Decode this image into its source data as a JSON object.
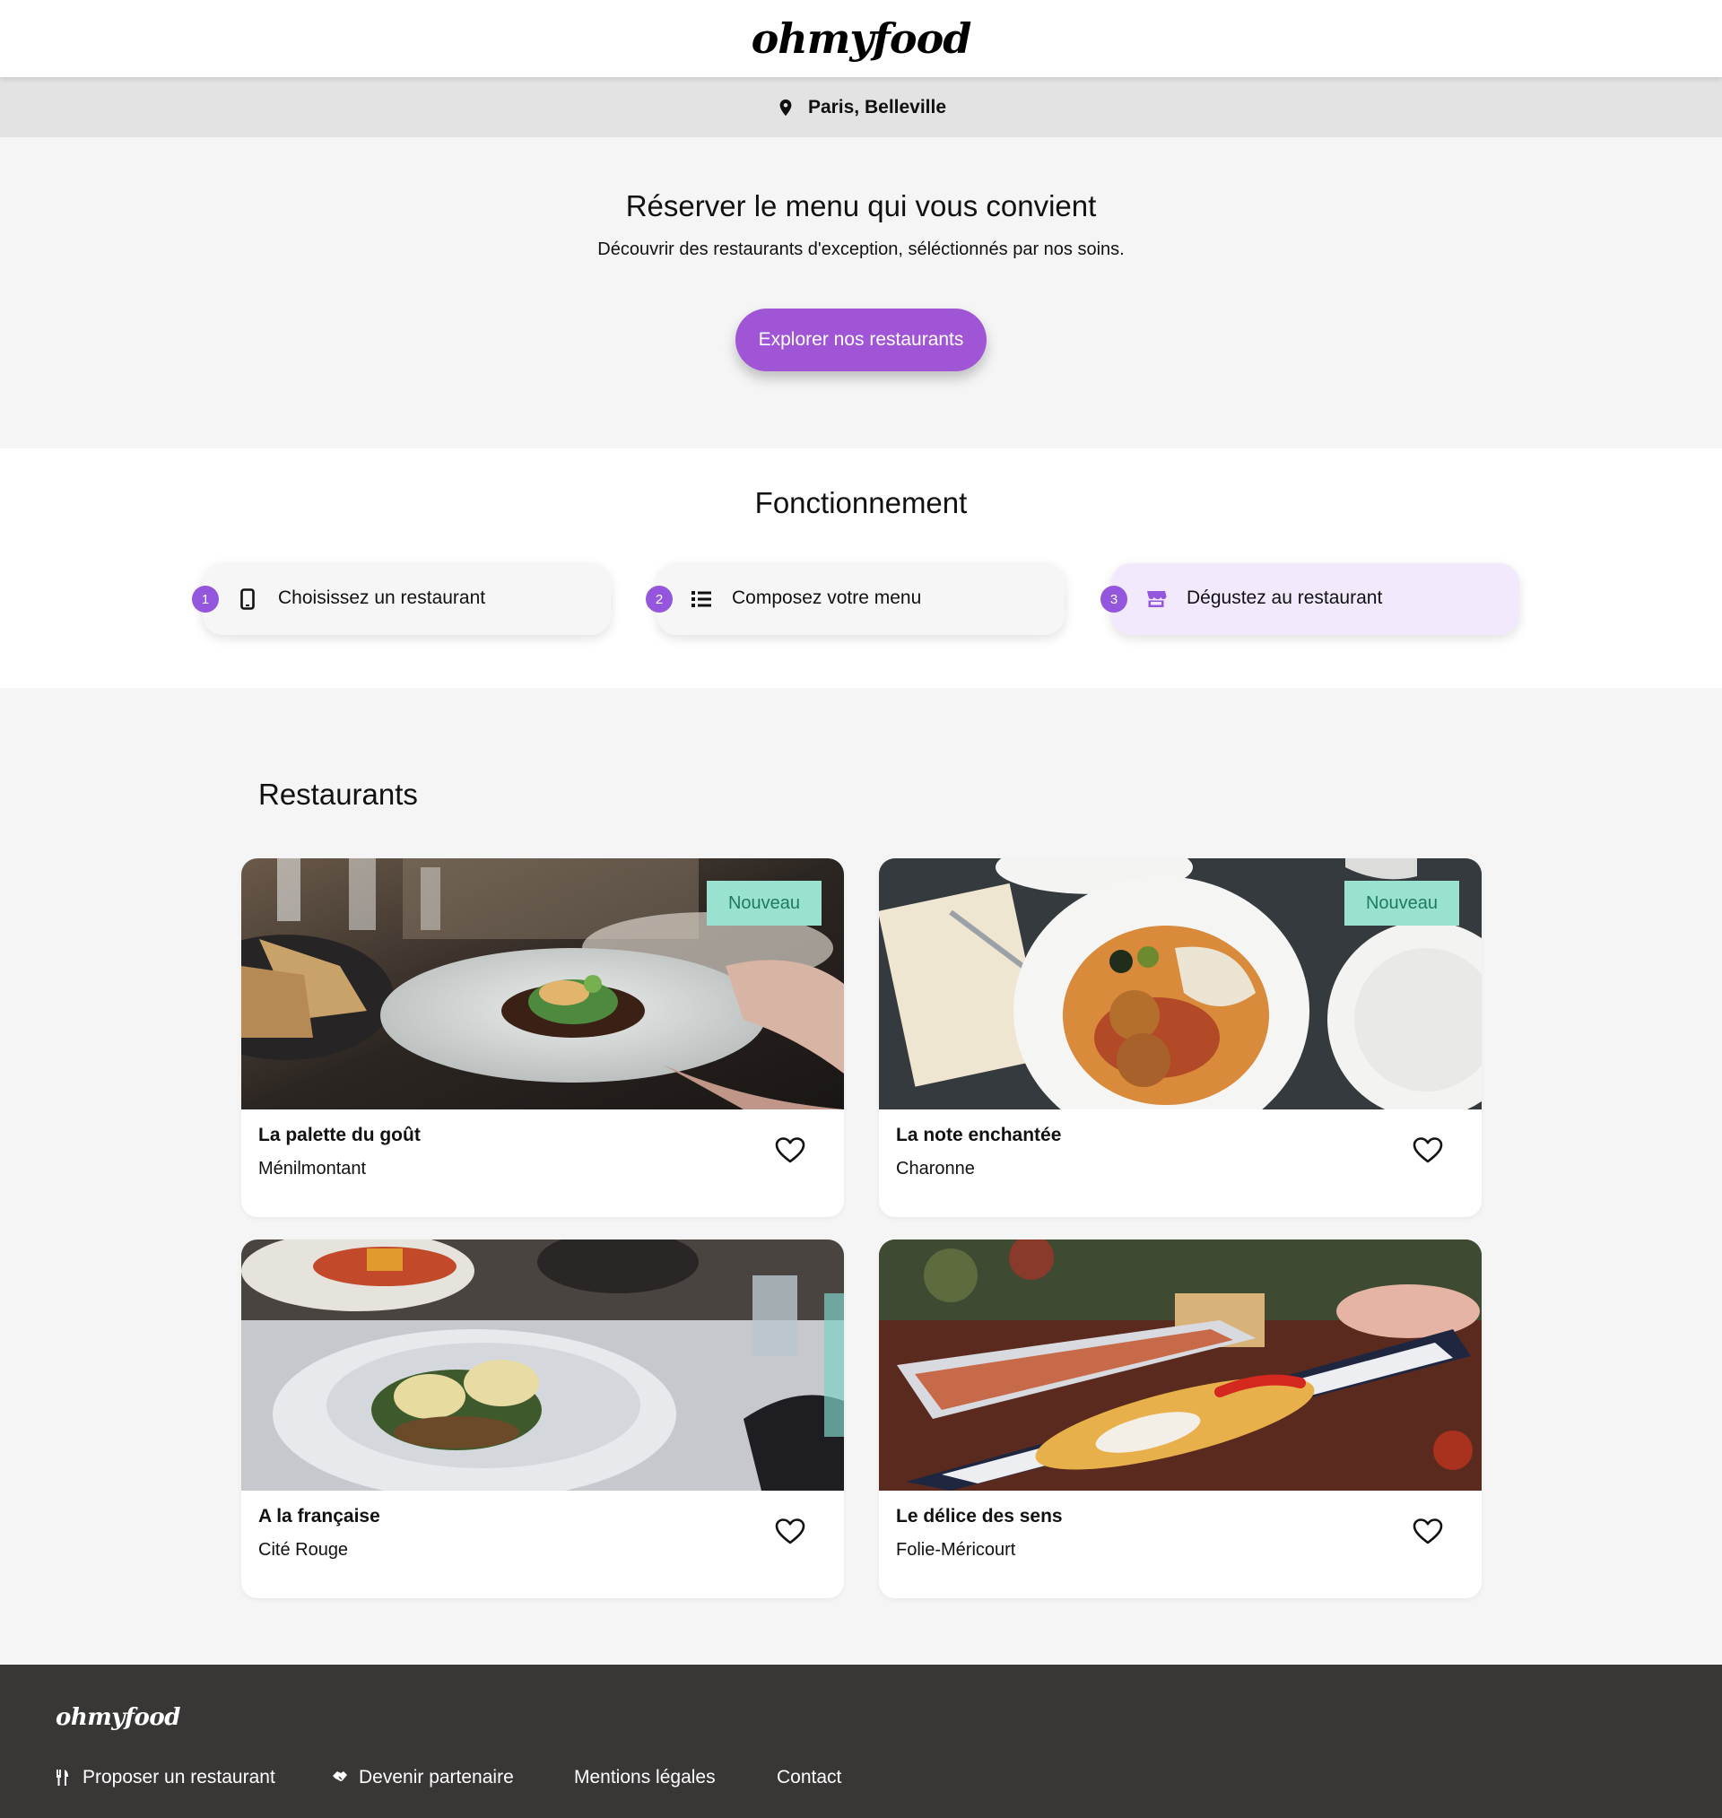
{
  "header": {
    "logo": "ohmyfood"
  },
  "location": {
    "icon": "map-pin-icon",
    "text": "Paris, Belleville"
  },
  "hero": {
    "title": "Réserver le menu qui vous convient",
    "subtitle": "Découvrir des restaurants d'exception, séléctionnés par nos soins.",
    "cta": "Explorer nos restaurants",
    "accent": "#a055d6"
  },
  "how": {
    "title": "Fonctionnement",
    "steps": [
      {
        "number": "1",
        "icon": "smartphone-icon",
        "label": "Choisissez un restaurant"
      },
      {
        "number": "2",
        "icon": "list-icon",
        "label": "Composez votre menu"
      },
      {
        "number": "3",
        "icon": "store-icon",
        "label": "Dégustez au restaurant"
      }
    ]
  },
  "restaurants": {
    "title": "Restaurants",
    "items": [
      {
        "name": "La palette du goût",
        "area": "Ménilmontant",
        "badge": "Nouveau",
        "image": "plated-dish-photo"
      },
      {
        "name": "La note enchantée",
        "area": "Charonne",
        "badge": "Nouveau",
        "image": "croquettes-plate-photo"
      },
      {
        "name": "A la française",
        "area": "Cité Rouge",
        "badge": "",
        "image": "eggs-benedict-photo"
      },
      {
        "name": "Le délice des sens",
        "area": "Folie-Méricourt",
        "badge": "",
        "image": "fish-platter-photo"
      }
    ],
    "badge_color": "#99e2d0"
  },
  "footer": {
    "logo": "ohmyfood",
    "links": [
      {
        "icon": "utensils-icon",
        "label": "Proposer un restaurant"
      },
      {
        "icon": "handshake-icon",
        "label": "Devenir partenaire"
      },
      {
        "icon": "",
        "label": "Mentions légales"
      },
      {
        "icon": "",
        "label": "Contact"
      }
    ]
  }
}
